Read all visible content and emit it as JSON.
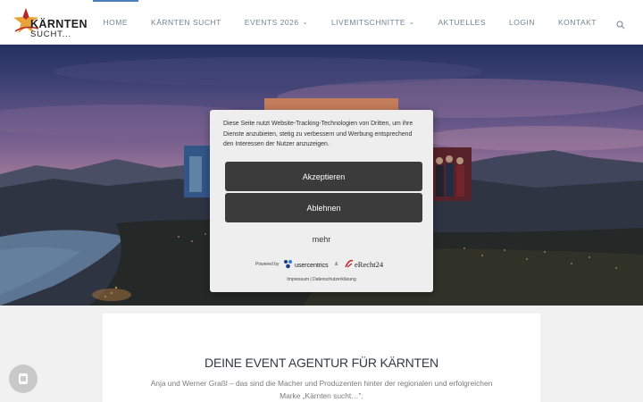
{
  "brand": {
    "logo_line1": "KÄRNTEN",
    "logo_line2": "SUCHT...",
    "star_color": "#e8a23a",
    "star_accent": "#b8262a"
  },
  "nav": {
    "items": [
      {
        "label": "HOME",
        "active": true,
        "dropdown": false
      },
      {
        "label": "KÄRNTEN SUCHT",
        "active": false,
        "dropdown": false
      },
      {
        "label": "EVENTS 2026",
        "active": false,
        "dropdown": true
      },
      {
        "label": "LIVEMITSCHNITTE",
        "active": false,
        "dropdown": true
      },
      {
        "label": "AKTUELLES",
        "active": false,
        "dropdown": false
      },
      {
        "label": "LOGIN",
        "active": false,
        "dropdown": false
      },
      {
        "label": "KONTAKT",
        "active": false,
        "dropdown": false
      }
    ],
    "search_icon": "search-icon",
    "accent_color": "#4a7fb8"
  },
  "consent": {
    "text": "Diese Seite nutzt Website-Tracking-Technologien von Dritten, um ihre Dienste anzubieten, stetig zu verbessern und Werbung entsprechend den Interessen der Nutzer anzuzeigen.",
    "accept_label": "Akzeptieren",
    "decline_label": "Ablehnen",
    "more_label": "mehr",
    "powered_by": "Powered by",
    "usercentrics": "usercentrics",
    "amp": "&",
    "erecht": "eRecht24",
    "impressum": "Impressum",
    "separator": "|",
    "datenschutz": "Datenschutzerklärung"
  },
  "content": {
    "title": "DEINE EVENT AGENTUR FÜR KÄRNTEN",
    "text_line1": "Anja und Werner Graßl – das sind die Macher und Produzenten hinter der regionalen und erfolgreichen",
    "text_line2": "Marke „Kärnten sucht…\"."
  },
  "floating_button_icon": "privacy-settings-icon"
}
